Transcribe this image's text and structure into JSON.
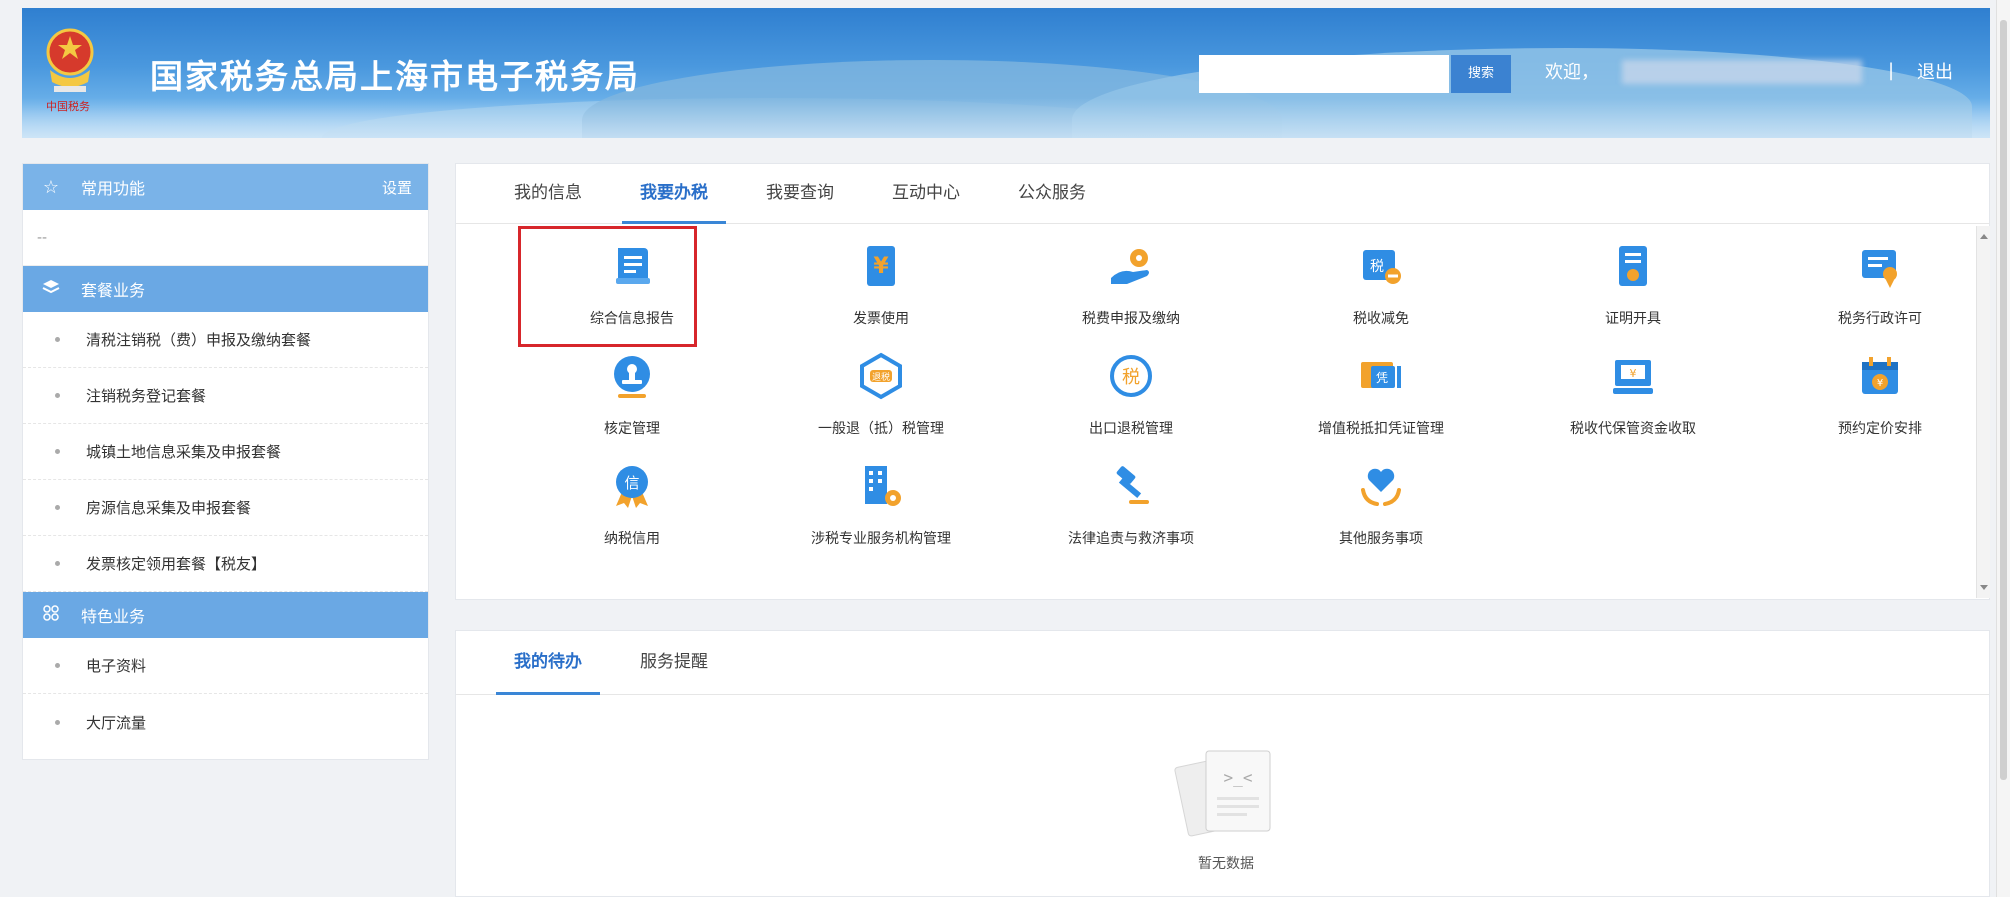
{
  "header": {
    "site_title": "国家税务总局上海市电子税务局",
    "search_placeholder": "",
    "search_button": "搜索",
    "welcome": "欢迎，",
    "separator": "|",
    "logout": "退出"
  },
  "sidebar": {
    "common": {
      "title": "常用功能",
      "setting": "设置",
      "empty_marker": "--"
    },
    "package": {
      "title": "套餐业务",
      "items": [
        "清税注销税（费）申报及缴纳套餐",
        "注销税务登记套餐",
        "城镇土地信息采集及申报套餐",
        "房源信息采集及申报套餐",
        "发票核定领用套餐【税友】"
      ]
    },
    "special": {
      "title": "特色业务",
      "items": [
        "电子资料",
        "大厅流量"
      ]
    }
  },
  "main": {
    "tabs": [
      "我的信息",
      "我要办税",
      "我要查询",
      "互动中心",
      "公众服务"
    ],
    "active_tab": "我要办税",
    "services": [
      {
        "label": "综合信息报告",
        "icon": "document-icon"
      },
      {
        "label": "发票使用",
        "icon": "invoice-yen-icon"
      },
      {
        "label": "税费申报及缴纳",
        "icon": "hand-coin-icon"
      },
      {
        "label": "税收减免",
        "icon": "tax-minus-icon"
      },
      {
        "label": "证明开具",
        "icon": "certificate-icon"
      },
      {
        "label": "税务行政许可",
        "icon": "license-badge-icon"
      },
      {
        "label": "核定管理",
        "icon": "stamp-icon"
      },
      {
        "label": "一般退（抵）税管理",
        "icon": "refund-hexagon-icon"
      },
      {
        "label": "出口退税管理",
        "icon": "tax-circle-icon"
      },
      {
        "label": "增值税抵扣凭证管理",
        "icon": "voucher-icon"
      },
      {
        "label": "税收代保管资金收取",
        "icon": "cash-box-icon"
      },
      {
        "label": "预约定价安排",
        "icon": "calendar-yen-icon"
      },
      {
        "label": "纳税信用",
        "icon": "credit-medal-icon"
      },
      {
        "label": "涉税专业服务机构管理",
        "icon": "building-gear-icon"
      },
      {
        "label": "法律追责与救济事项",
        "icon": "gavel-icon"
      },
      {
        "label": "其他服务事项",
        "icon": "heart-hands-icon"
      }
    ]
  },
  "todo": {
    "tabs": [
      "我的待办",
      "服务提醒"
    ],
    "active_tab": "我的待办",
    "empty_text": "暂无数据",
    "empty_face": ">_<"
  },
  "colors": {
    "accent": "#3a86d6",
    "sidebar_header": "#6aa8e4",
    "highlight": "#d7262b",
    "icon_blue": "#2f8de4",
    "icon_orange": "#f2a22c"
  }
}
